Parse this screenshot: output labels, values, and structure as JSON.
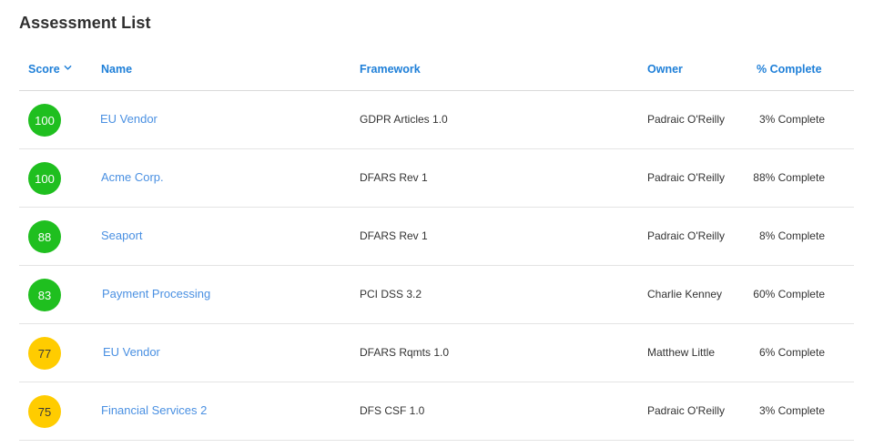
{
  "page": {
    "title": "Assessment List"
  },
  "colors": {
    "accent": "#1e7fd8",
    "link": "#4a90e2",
    "score_high": "#1fbf1f",
    "score_medium": "#ffcc00"
  },
  "table": {
    "columns": {
      "score": "Score",
      "name": "Name",
      "framework": "Framework",
      "owner": "Owner",
      "complete": "% Complete"
    },
    "sort_icon": "chevron-down-icon",
    "rows": [
      {
        "score": "100",
        "level": "high",
        "name": "EU Vendor",
        "framework": "GDPR Articles 1.0",
        "owner": "Padraic O'Reilly",
        "complete": "3% Complete"
      },
      {
        "score": "100",
        "level": "high",
        "name": "Acme Corp.",
        "framework": "DFARS Rev 1",
        "owner": "Padraic O'Reilly",
        "complete": "88% Complete"
      },
      {
        "score": "88",
        "level": "high",
        "name": "Seaport",
        "framework": "DFARS Rev 1",
        "owner": "Padraic O'Reilly",
        "complete": "8% Complete"
      },
      {
        "score": "83",
        "level": "high",
        "name": "Payment Processing",
        "framework": "PCI DSS 3.2",
        "owner": "Charlie Kenney",
        "complete": "60% Complete"
      },
      {
        "score": "77",
        "level": "medium",
        "name": "EU Vendor",
        "framework": "DFARS Rqmts 1.0",
        "owner": "Matthew Little",
        "complete": "6% Complete"
      },
      {
        "score": "75",
        "level": "medium",
        "name": "Financial Services 2",
        "framework": "DFS CSF 1.0",
        "owner": "Padraic O'Reilly",
        "complete": "3% Complete"
      }
    ]
  }
}
